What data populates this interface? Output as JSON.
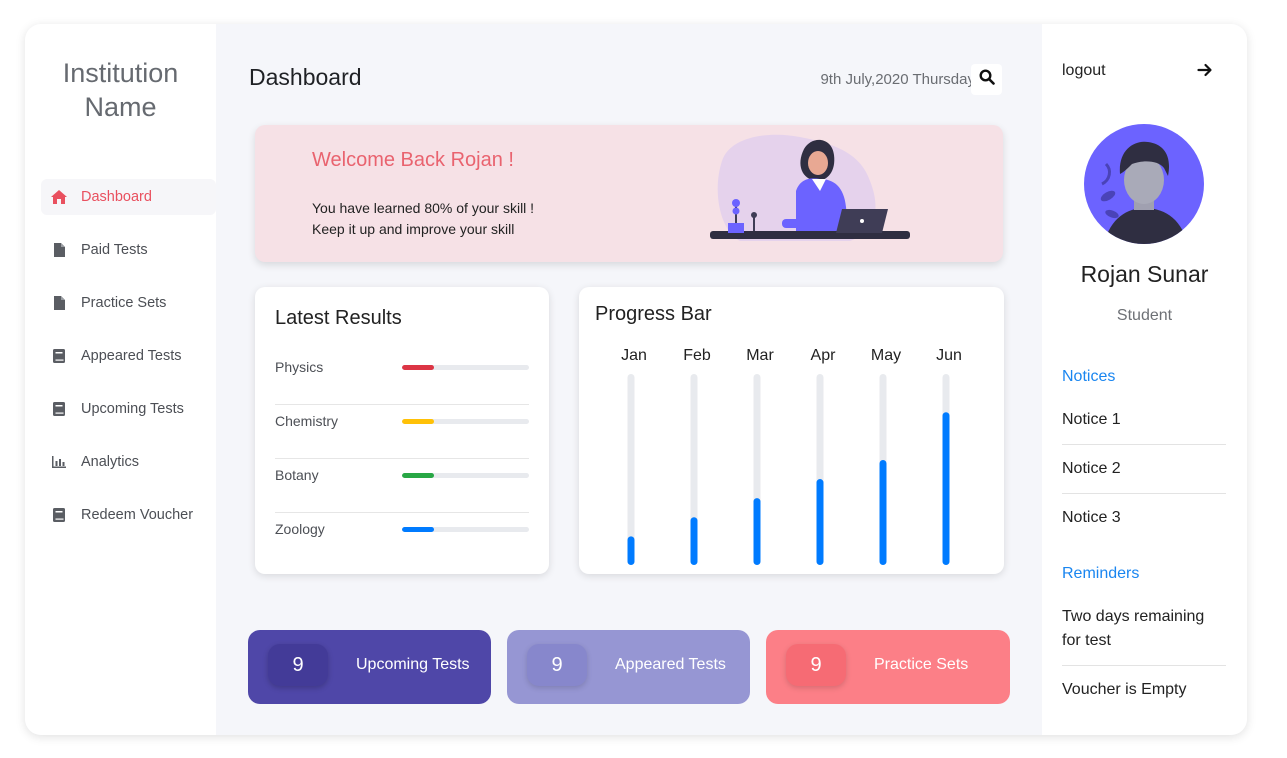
{
  "sidebar": {
    "institution_line1": "Institution",
    "institution_line2": "Name",
    "items": [
      {
        "label": "Dashboard",
        "icon": "home-icon"
      },
      {
        "label": "Paid Tests",
        "icon": "file-icon"
      },
      {
        "label": "Practice Sets",
        "icon": "file-icon"
      },
      {
        "label": "Appeared Tests",
        "icon": "book-icon"
      },
      {
        "label": "Upcoming Tests",
        "icon": "book-icon"
      },
      {
        "label": "Analytics",
        "icon": "bar-chart-icon"
      },
      {
        "label": "Redeem Voucher",
        "icon": "book-icon"
      }
    ]
  },
  "header": {
    "title": "Dashboard",
    "date": "9th July,2020 Thursday"
  },
  "welcome": {
    "title": "Welcome Back Rojan !",
    "line1": "You have learned 80% of your skill !",
    "line2": "Keep it up and improve your skill"
  },
  "results": {
    "title": "Latest Results",
    "subjects": [
      {
        "name": "Physics",
        "progress": 0.25,
        "color": "#dc3545"
      },
      {
        "name": "Chemistry",
        "progress": 0.25,
        "color": "#ffc107"
      },
      {
        "name": "Botany",
        "progress": 0.25,
        "color": "#28a745"
      },
      {
        "name": "Zoology",
        "progress": 0.25,
        "color": "#007bff"
      }
    ]
  },
  "progress": {
    "title": "Progress Bar",
    "months": [
      {
        "label": "Jan",
        "value": 0.15
      },
      {
        "label": "Feb",
        "value": 0.25
      },
      {
        "label": "Mar",
        "value": 0.35
      },
      {
        "label": "Apr",
        "value": 0.45
      },
      {
        "label": "May",
        "value": 0.55
      },
      {
        "label": "Jun",
        "value": 0.8
      }
    ],
    "color": "#007bff"
  },
  "stats": [
    {
      "count": "9",
      "label": "Upcoming Tests"
    },
    {
      "count": "9",
      "label": "Appeared Tests"
    },
    {
      "count": "9",
      "label": "Practice Sets"
    }
  ],
  "profile": {
    "logout": "logout",
    "name": "Rojan Sunar",
    "role": "Student"
  },
  "notices": {
    "title": "Notices",
    "items": [
      "Notice 1",
      "Notice 2",
      "Notice 3"
    ]
  },
  "reminders": {
    "title": "Reminders",
    "items": [
      "Two days remaining for test",
      "Voucher is Empty"
    ]
  },
  "colors": {
    "accent": "#e9505f",
    "link": "#1a86f0",
    "stat_upcoming": "#4f47a8",
    "stat_appeared": "#9696d3",
    "stat_practice": "#fc7f87"
  }
}
